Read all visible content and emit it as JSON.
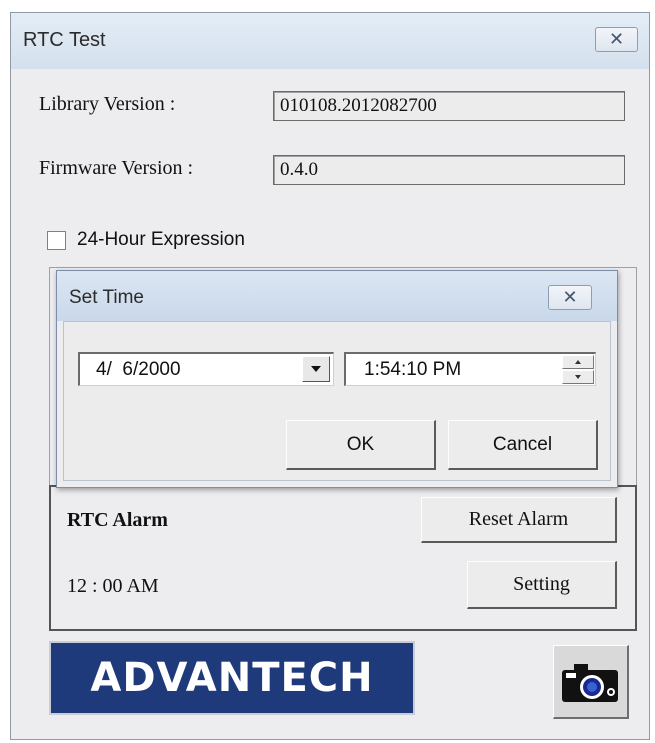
{
  "window": {
    "title": "RTC Test",
    "close_icon": "close-icon"
  },
  "info": {
    "library_label": "Library Version :",
    "library_value": "010108.2012082700",
    "firmware_label": "Firmware Version :",
    "firmware_value": "0.4.0"
  },
  "options": {
    "hour24_label": "24-Hour Expression",
    "hour24_checked": false
  },
  "dialog": {
    "title": "Set Time",
    "date_value": "4/  6/2000",
    "time_value": "1:54:10 PM",
    "ok_label": "OK",
    "cancel_label": "Cancel"
  },
  "alarm": {
    "title": "RTC Alarm",
    "time": "12 : 00 AM",
    "reset_label": "Reset Alarm",
    "setting_label": "Setting"
  },
  "branding": {
    "logo_text": "ADVANTECH",
    "logo_color": "#1f3a7a"
  },
  "icons": {
    "camera": "camera-icon"
  }
}
